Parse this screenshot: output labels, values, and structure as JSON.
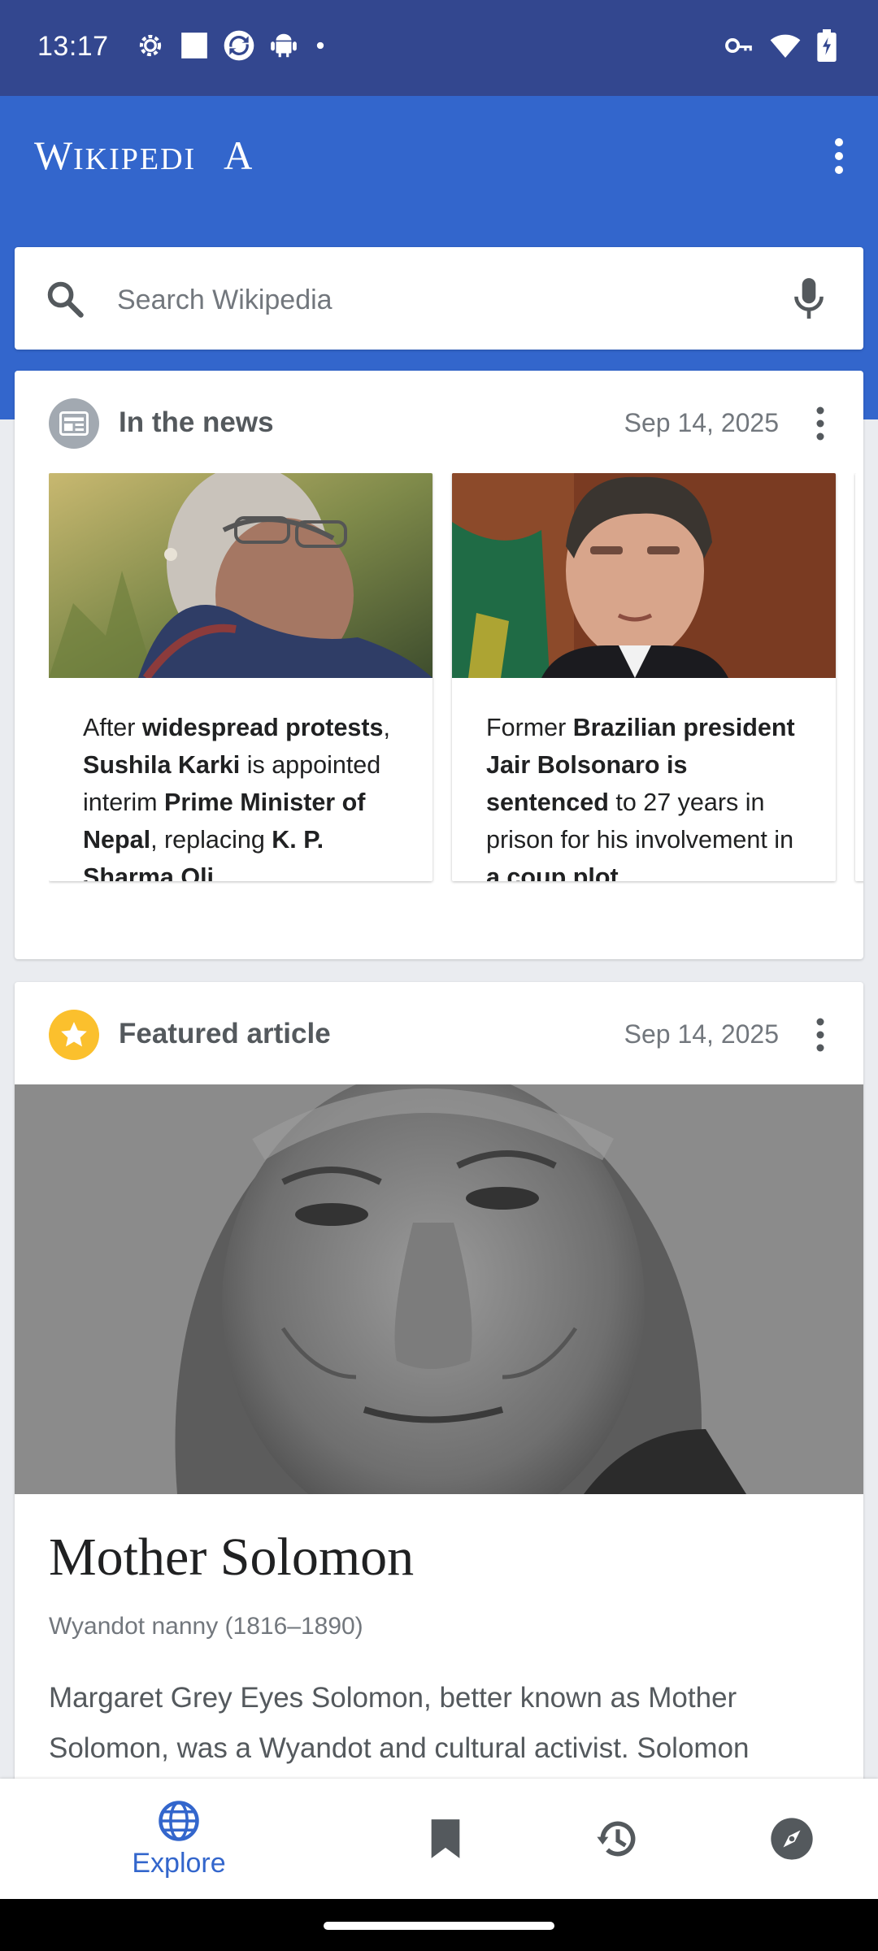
{
  "status_bar": {
    "time": "13:17"
  },
  "app_bar": {
    "logo_text": "Wikipedia"
  },
  "search": {
    "placeholder": "Search Wikipedia"
  },
  "news_card": {
    "title": "In the news",
    "date": "Sep 14, 2025",
    "items": [
      {
        "segments": [
          {
            "t": "After ",
            "b": false
          },
          {
            "t": "widespread protests",
            "b": true
          },
          {
            "t": ", ",
            "b": false
          },
          {
            "t": "Sushila Karki",
            "b": true
          },
          {
            "t": " is appointed interim ",
            "b": false
          },
          {
            "t": "Prime Minister of Nepal",
            "b": true
          },
          {
            "t": ", replacing ",
            "b": false
          },
          {
            "t": "K. P. Sharma Oli",
            "b": true
          },
          {
            "t": ".",
            "b": false
          }
        ]
      },
      {
        "segments": [
          {
            "t": "Former ",
            "b": false
          },
          {
            "t": "Brazilian president Jair Bolsonaro is sentenced",
            "b": true
          },
          {
            "t": " to 27 years in prison for his involvement in ",
            "b": false
          },
          {
            "t": "a coup plot",
            "b": true
          },
          {
            "t": ".",
            "b": false
          }
        ]
      }
    ]
  },
  "featured_card": {
    "title": "Featured article",
    "date": "Sep 14, 2025",
    "article_title": "Mother Solomon",
    "article_description": "Wyandot nanny (1816–1890)",
    "article_extract": "Margaret Grey Eyes Solomon, better known as Mother Solomon, was a Wyandot and cultural activist. Solomon"
  },
  "bottom_nav": {
    "items": [
      {
        "label": "Explore",
        "icon": "globe-icon",
        "active": true
      },
      {
        "label": "",
        "icon": "bookmark-icon",
        "active": false
      },
      {
        "label": "",
        "icon": "history-icon",
        "active": false
      },
      {
        "label": "",
        "icon": "compass-icon",
        "active": false
      }
    ]
  },
  "colors": {
    "accent": "#3366cc",
    "status_bar": "#33478f",
    "featured_star": "#fbc02d"
  }
}
